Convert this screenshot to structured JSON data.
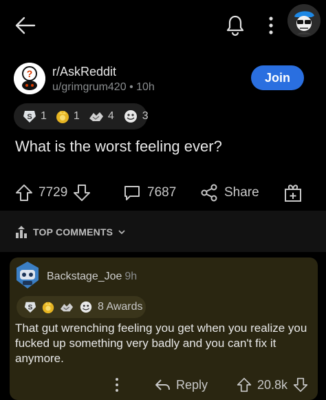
{
  "post": {
    "subreddit": "r/AskReddit",
    "author": "u/grimgrum420",
    "separator": "•",
    "age": "10h",
    "join_label": "Join",
    "awards": [
      {
        "icon": "silver-award-icon",
        "count": "1"
      },
      {
        "icon": "gold-award-icon",
        "count": "1"
      },
      {
        "icon": "wholesome-award-icon",
        "count": "4"
      },
      {
        "icon": "helpful-award-icon",
        "count": "3"
      }
    ],
    "title": "What is the worst feeling ever?",
    "votes": "7729",
    "comments": "7687",
    "share_label": "Share"
  },
  "section": {
    "label": "TOP COMMENTS"
  },
  "comment": {
    "username": "Backstage_Joe",
    "age": "9h",
    "awards_label": "8 Awards",
    "body": "That gut wrenching feeling you get when you realize you fucked up something very badly and you can't fix it anymore.",
    "reply_label": "Reply",
    "votes": "20.8k"
  },
  "colors": {
    "background": "#000000",
    "accent": "#2a6fe0",
    "comment_bg": "#2a2611"
  }
}
